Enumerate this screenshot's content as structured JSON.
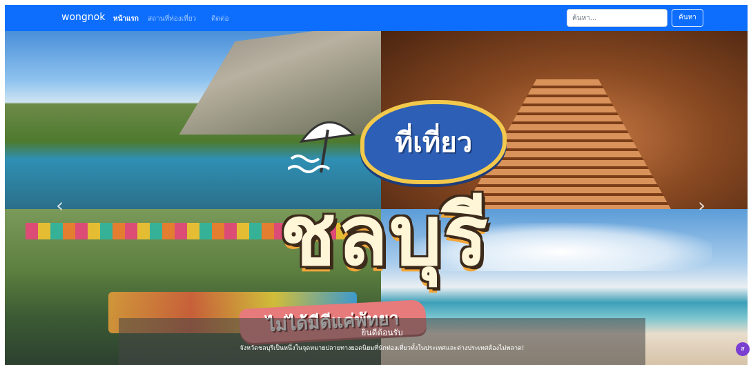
{
  "navbar": {
    "brand": "wongnok",
    "links": [
      {
        "label": "หน้าแรก",
        "active": true
      },
      {
        "label": "สถานที่ท่องเที่ยว",
        "active": false
      },
      {
        "label": "ติดต่อ",
        "active": false
      }
    ],
    "search": {
      "placeholder": "ค้นหา...",
      "button_label": "ค้นหา"
    }
  },
  "carousel": {
    "banner": {
      "badge_text": "ที่เที่ยว",
      "title": "ชลบุรี",
      "ribbon_text": "ไม่ได้มีดีแค่พัทยา"
    },
    "caption": {
      "title": "ยินดีต้อนรับ",
      "text": "จังหวัดชลบุรีเป็นหนึ่งในจุดหมายปลายทางยอดนิยมที่นักท่องเที่ยวทั้งในประเทศและต่างประเทศต้องไม่พลาด!"
    },
    "controls": {
      "prev_icon": "‹",
      "next_icon": "›"
    }
  },
  "widget": {
    "icon": "chat-icon",
    "label": "ส"
  },
  "colors": {
    "navbar": "#0d6efd",
    "badge": "#2c5fb5",
    "ribbon": "#e77a7a"
  }
}
